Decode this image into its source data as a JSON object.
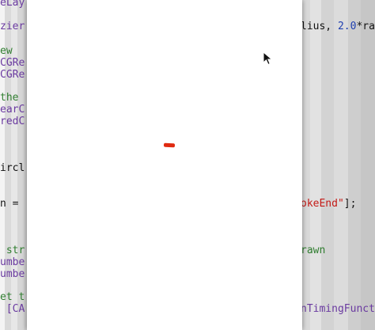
{
  "editor": {
    "left_lines": [
      {
        "text": "eLay",
        "color": "purple"
      },
      {
        "text": "zier",
        "color": "purple"
      },
      {
        "text": "ew",
        "color": "green"
      },
      {
        "text": "CGRe",
        "color": "purple"
      },
      {
        "text": "CGRe",
        "color": "purple"
      },
      {
        "text": "the",
        "color": "green"
      },
      {
        "text": "earC",
        "color": "purple"
      },
      {
        "text": "redC",
        "color": "purple"
      },
      {
        "text": "ircl",
        "color": "plain"
      },
      {
        "text": "n =",
        "color": "plain"
      },
      {
        "text": " str",
        "color": "green"
      },
      {
        "text": "umbe",
        "color": "purple"
      },
      {
        "text": "umbe",
        "color": "purple"
      },
      {
        "text": "et t",
        "color": "green"
      },
      {
        "text": " [CA",
        "color": "purple"
      }
    ],
    "right_lines": [
      {
        "segments": [
          {
            "text": "lius, ",
            "color": "plain"
          },
          {
            "text": "2.0",
            "color": "blue"
          },
          {
            "text": "*radi",
            "color": "plain"
          }
        ]
      },
      {
        "segments": [
          {
            "text": "okeEnd\"",
            "color": "red"
          },
          {
            "text": "];",
            "color": "plain"
          }
        ]
      },
      {
        "segments": [
          {
            "text": "rawn",
            "color": "green"
          }
        ]
      },
      {
        "segments": [
          {
            "text": "nTimingFuncti",
            "color": "purple"
          }
        ]
      }
    ]
  },
  "canvas": {
    "background": "#ffffff",
    "stroke_color": "#e02a10"
  },
  "cursor": {
    "icon": "mouse-pointer-icon"
  }
}
